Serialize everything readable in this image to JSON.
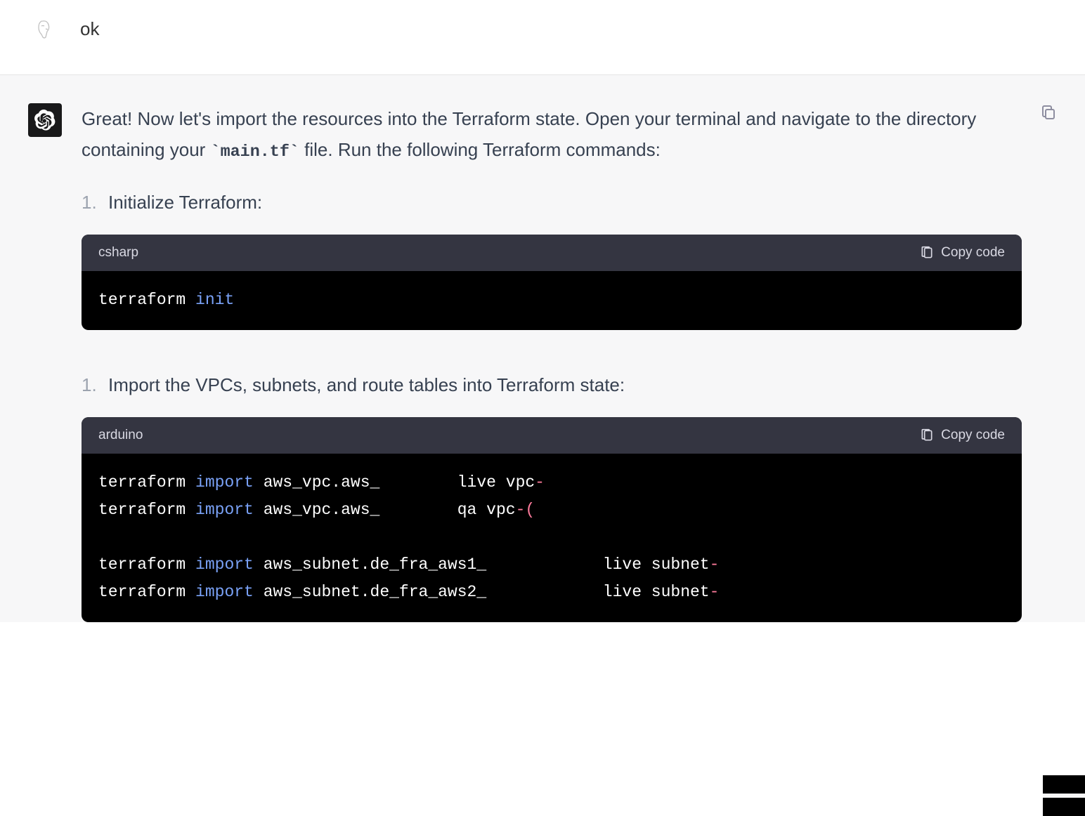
{
  "user": {
    "message": "ok"
  },
  "assistant": {
    "intro_before_code": "Great! Now let's import the resources into the Terraform state. Open your terminal and navigate to the directory containing your ",
    "inline_code": "`main.tf`",
    "intro_after_code": " file. Run the following Terraform commands:",
    "step1": {
      "num": "1.",
      "text": "Initialize Terraform:"
    },
    "code1": {
      "lang": "csharp",
      "copy_label": "Copy code",
      "line1_cmd": "terraform",
      "line1_sub": "init"
    },
    "step2": {
      "num": "1.",
      "text": "Import the VPCs, subnets, and route tables into Terraform state:"
    },
    "code2": {
      "lang": "arduino",
      "copy_label": "Copy code",
      "lines": [
        {
          "cmd": "terraform",
          "sub": "import",
          "arg": "aws_vpc.aws_",
          "gap": "        ",
          "mid": "live vpc",
          "suffix": "-"
        },
        {
          "cmd": "terraform",
          "sub": "import",
          "arg": "aws_vpc.aws_",
          "gap": "        ",
          "mid": "qa vpc",
          "suffix": "-("
        },
        {
          "blank": true
        },
        {
          "cmd": "terraform",
          "sub": "import",
          "arg": "aws_subnet.de_fra_aws1_",
          "gap": "            ",
          "mid": "live subnet",
          "suffix": "-"
        },
        {
          "cmd": "terraform",
          "sub": "import",
          "arg": "aws_subnet.de_fra_aws2_",
          "gap": "            ",
          "mid": "live subnet",
          "suffix": "-"
        }
      ]
    }
  }
}
